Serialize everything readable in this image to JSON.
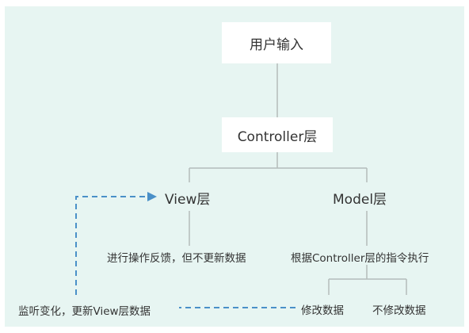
{
  "nodes": {
    "user_input": "用户输入",
    "controller": "Controller层",
    "view": "View层",
    "model": "Model层",
    "view_action": "进行操作反馈，但不更新数据",
    "model_action": "根据Controller层的指令执行",
    "modify_data": "修改数据",
    "no_modify_data": "不修改数据",
    "listen_update": "监听变化，更新View层数据"
  },
  "colors": {
    "background": "#e7f5f2",
    "box_fill": "#ffffff",
    "solid_line": "#b4bcbb",
    "dashed_line": "#4a90c8",
    "text": "#333333"
  }
}
